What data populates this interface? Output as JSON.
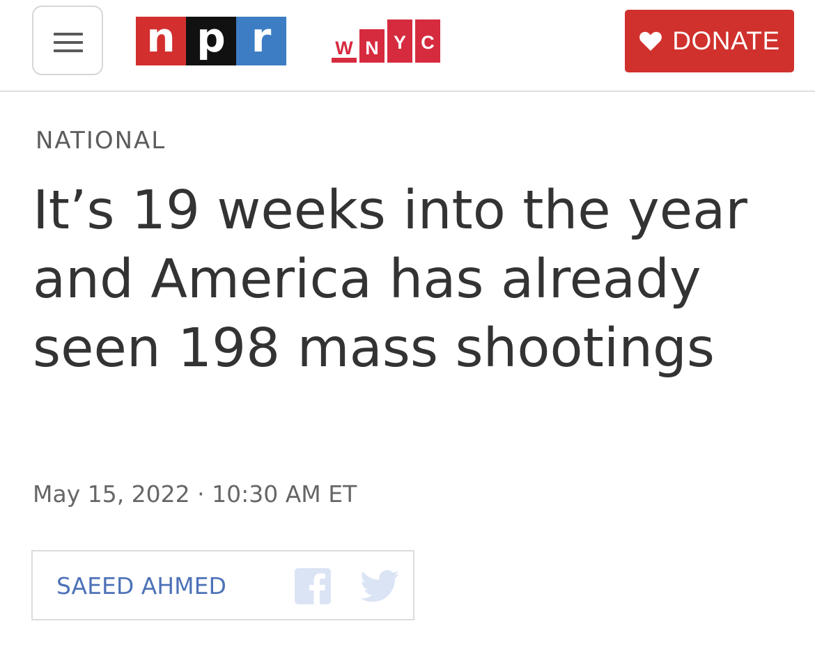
{
  "header": {
    "menu_icon": "hamburger-menu-icon",
    "npr_logo": {
      "letters": [
        "n",
        "p",
        "r"
      ],
      "colors": [
        "#d32f2f",
        "#111111",
        "#3c7dc4"
      ]
    },
    "wnyc_logo": {
      "letters": [
        "W",
        "N",
        "Y",
        "C"
      ],
      "color": "#d62b3f"
    },
    "donate": {
      "label": "DONATE",
      "icon": "heart-icon",
      "color": "#d0312d"
    }
  },
  "article": {
    "section": "NATIONAL",
    "headline": "It’s 19 weeks into the year and America has already seen 198 mass shootings",
    "dateline": "May 15, 2022 · 10:30 AM ET",
    "author": "SAEED AHMED",
    "share_icons": [
      "facebook-icon",
      "twitter-icon"
    ],
    "link_color": "#4e72b8"
  }
}
